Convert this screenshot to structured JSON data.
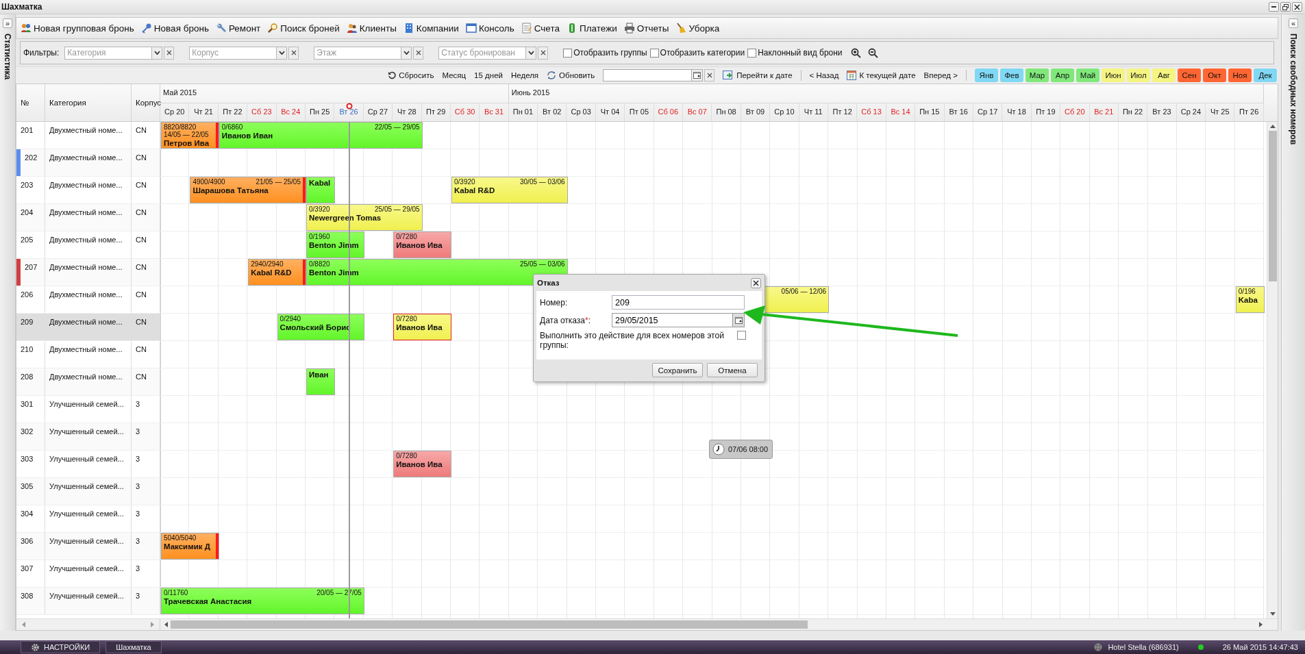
{
  "window": {
    "title": "Шахматка"
  },
  "left_panel": {
    "toggle": "»",
    "title": "Статистика"
  },
  "right_panel": {
    "toggle": "«",
    "title": "Поиск свободных номеров"
  },
  "toolbar": [
    "Новая групповая бронь",
    "Новая бронь",
    "Ремонт",
    "Поиск броней",
    "Клиенты",
    "Компании",
    "Консоль",
    "Счета",
    "Платежи",
    "Отчеты",
    "Уборка"
  ],
  "filters": {
    "label": "Фильтры:",
    "combos": [
      {
        "placeholder": "Категория"
      },
      {
        "placeholder": "Корпус"
      },
      {
        "placeholder": "Этаж"
      },
      {
        "placeholder": "Статус бронирован"
      }
    ],
    "checkboxes": [
      {
        "label": "Отобразить группы",
        "checked": false
      },
      {
        "label": "Отобразить категории",
        "checked": false
      },
      {
        "label": "Наклонный вид брони",
        "checked": false
      }
    ]
  },
  "nav": {
    "reset": "Сбросить",
    "views": [
      "Месяц",
      "15 дней",
      "Неделя"
    ],
    "refresh": "Обновить",
    "goto": "Перейти к дате",
    "back": "< Назад",
    "today": "К текущей дате",
    "forward": "Вперед >",
    "months": [
      {
        "label": "Янв",
        "color": "#80d8f4"
      },
      {
        "label": "Фев",
        "color": "#80d8f4"
      },
      {
        "label": "Мар",
        "color": "#80e87a"
      },
      {
        "label": "Апр",
        "color": "#80e87a"
      },
      {
        "label": "Май",
        "color": "#80e87a"
      },
      {
        "label": "Июн",
        "color": "#f4f482"
      },
      {
        "label": "Июл",
        "color": "#f4f482"
      },
      {
        "label": "Авг",
        "color": "#f4f482"
      },
      {
        "label": "Сен",
        "color": "#ff6633"
      },
      {
        "label": "Окт",
        "color": "#ff6633"
      },
      {
        "label": "Ноя",
        "color": "#ff6633"
      },
      {
        "label": "Дек",
        "color": "#80d8f4"
      }
    ]
  },
  "grid": {
    "columns": [
      "№",
      "Категория",
      "Корпус"
    ],
    "months": [
      {
        "label": "Май 2015",
        "days": [
          {
            "label": "Ср 20",
            "kind": "weekday"
          },
          {
            "label": "Чт 21",
            "kind": "weekday"
          },
          {
            "label": "Пт 22",
            "kind": "weekday"
          },
          {
            "label": "Сб 23",
            "kind": "weekend"
          },
          {
            "label": "Вс 24",
            "kind": "weekend"
          },
          {
            "label": "Пн 25",
            "kind": "weekday"
          },
          {
            "label": "Вт 26",
            "kind": "today"
          },
          {
            "label": "Ср 27",
            "kind": "weekday"
          },
          {
            "label": "Чт 28",
            "kind": "weekday"
          },
          {
            "label": "Пт 29",
            "kind": "weekday"
          },
          {
            "label": "Сб 30",
            "kind": "weekend"
          },
          {
            "label": "Вс 31",
            "kind": "weekend"
          }
        ]
      },
      {
        "label": "Июнь 2015",
        "days": [
          {
            "label": "Пн 01",
            "kind": "weekday"
          },
          {
            "label": "Вт 02",
            "kind": "weekday"
          },
          {
            "label": "Ср 03",
            "kind": "weekday"
          },
          {
            "label": "Чт 04",
            "kind": "weekday"
          },
          {
            "label": "Пт 05",
            "kind": "weekday"
          },
          {
            "label": "Сб 06",
            "kind": "weekend"
          },
          {
            "label": "Вс 07",
            "kind": "weekend"
          },
          {
            "label": "Пн 08",
            "kind": "weekday"
          },
          {
            "label": "Вт 09",
            "kind": "weekday"
          },
          {
            "label": "Ср 10",
            "kind": "weekday"
          },
          {
            "label": "Чт 11",
            "kind": "weekday"
          },
          {
            "label": "Пт 12",
            "kind": "weekday"
          },
          {
            "label": "Сб 13",
            "kind": "weekend"
          },
          {
            "label": "Вс 14",
            "kind": "weekend"
          },
          {
            "label": "Пн 15",
            "kind": "weekday"
          },
          {
            "label": "Вт 16",
            "kind": "weekday"
          },
          {
            "label": "Ср 17",
            "kind": "weekday"
          },
          {
            "label": "Чт 18",
            "kind": "weekday"
          },
          {
            "label": "Пт 19",
            "kind": "weekday"
          },
          {
            "label": "Сб 20",
            "kind": "weekend"
          },
          {
            "label": "Вс 21",
            "kind": "weekend"
          },
          {
            "label": "Пн 22",
            "kind": "weekday"
          },
          {
            "label": "Вт 23",
            "kind": "weekday"
          },
          {
            "label": "Ср 24",
            "kind": "weekday"
          },
          {
            "label": "Чт 25",
            "kind": "weekday"
          },
          {
            "label": "Пт 26",
            "kind": "weekday"
          }
        ]
      }
    ],
    "rows": [
      {
        "number": "201",
        "category": "Двухместный номе...",
        "building": "CN",
        "selected": false,
        "timeline": [
          {
            "kind": "paid",
            "amount": "8820/8820",
            "dates": "14/05 — 22/05",
            "guest": "Петров Ива",
            "selected": false,
            "nights": [
              {
                "kind": "night"
              },
              {
                "kind": "night"
              }
            ]
          },
          {
            "kind": "checked_in",
            "amount": "0/6860",
            "dates": "22/05 — 29/05",
            "guest": "Иванов Иван",
            "selected": false,
            "nights": [
              {
                "kind": "night"
              },
              {
                "kind": "night"
              },
              {
                "kind": "night"
              },
              {
                "kind": "night"
              },
              {
                "kind": "night"
              },
              {
                "kind": "night"
              },
              {
                "kind": "night"
              }
            ]
          }
        ]
      },
      {
        "number": "202",
        "category": "Двухместный номе...",
        "building": "CN",
        "selected": false,
        "color": "#5b8def"
      },
      {
        "number": "203",
        "category": "Двухместный номе...",
        "building": "CN",
        "selected": false,
        "timeline": [
          {
            "kind": "free"
          },
          {
            "kind": "paid",
            "amount": "4900/4900",
            "dates": "21/05 — 25/05",
            "guest": "Шарашова Татьяна",
            "selected": false,
            "nights": [
              {
                "kind": "night"
              },
              {
                "kind": "night"
              },
              {
                "kind": "night"
              },
              {
                "kind": "night"
              }
            ]
          },
          {
            "kind": "checked_in",
            "guest": "Kabal",
            "selected": false,
            "nights": [
              {
                "kind": "night"
              }
            ]
          },
          {
            "kind": "free"
          },
          {
            "kind": "free"
          },
          {
            "kind": "free"
          },
          {
            "kind": "free"
          },
          {
            "kind": "reserved",
            "amount": "0/3920",
            "dates": "30/05 — 03/06",
            "guest": "Kabal R&D",
            "selected": false,
            "nights": [
              {
                "kind": "night"
              },
              {
                "kind": "night"
              },
              {
                "kind": "night"
              },
              {
                "kind": "night"
              }
            ]
          }
        ]
      },
      {
        "number": "204",
        "category": "Двухместный номе...",
        "building": "CN",
        "selected": false,
        "timeline": [
          {
            "kind": "free"
          },
          {
            "kind": "free"
          },
          {
            "kind": "free"
          },
          {
            "kind": "free"
          },
          {
            "kind": "free"
          },
          {
            "kind": "reserved",
            "amount": "0/3920",
            "dates": "25/05 — 29/05",
            "guest": "Newergreen Tomas",
            "selected": false,
            "nights": [
              {
                "kind": "night"
              },
              {
                "kind": "night"
              },
              {
                "kind": "night"
              },
              {
                "kind": "night"
              }
            ]
          }
        ]
      },
      {
        "number": "205",
        "category": "Двухместный номе...",
        "building": "CN",
        "selected": false,
        "timeline": [
          {
            "kind": "free"
          },
          {
            "kind": "free"
          },
          {
            "kind": "free"
          },
          {
            "kind": "free"
          },
          {
            "kind": "free"
          },
          {
            "kind": "checked_in",
            "amount": "0/1960",
            "guest": "Benton Jimm",
            "selected": false,
            "nights": [
              {
                "kind": "night"
              },
              {
                "kind": "night"
              }
            ]
          },
          {
            "kind": "free"
          },
          {
            "kind": "cancelled",
            "amount": "0/7280",
            "guest": "Иванов Ива",
            "selected": false,
            "nights": [
              {
                "kind": "night"
              },
              {
                "kind": "night"
              }
            ]
          }
        ]
      },
      {
        "number": "207",
        "category": "Двухместный номе...",
        "building": "CN",
        "selected": false,
        "color": "#d04040",
        "timeline": [
          {
            "kind": "free"
          },
          {
            "kind": "free"
          },
          {
            "kind": "free"
          },
          {
            "kind": "paid",
            "amount": "2940/2940",
            "guest": "Kabal R&D",
            "selected": false,
            "nights": [
              {
                "kind": "night"
              },
              {
                "kind": "night"
              }
            ]
          },
          {
            "kind": "checked_in",
            "amount": "0/8820",
            "dates": "25/05 — 03/06",
            "guest": "Benton Jimm",
            "selected": false,
            "nights": [
              {
                "kind": "night"
              },
              {
                "kind": "night"
              },
              {
                "kind": "night"
              },
              {
                "kind": "night"
              },
              {
                "kind": "night"
              },
              {
                "kind": "night"
              },
              {
                "kind": "night"
              },
              {
                "kind": "night"
              },
              {
                "kind": "night"
              }
            ]
          }
        ]
      },
      {
        "number": "206",
        "category": "Двухместный номе...",
        "building": "CN",
        "selected": false,
        "timeline": [
          {
            "kind": "free"
          },
          {
            "kind": "free"
          },
          {
            "kind": "free"
          },
          {
            "kind": "free"
          },
          {
            "kind": "free"
          },
          {
            "kind": "free"
          },
          {
            "kind": "free"
          },
          {
            "kind": "free"
          },
          {
            "kind": "free"
          },
          {
            "kind": "free"
          },
          {
            "kind": "free"
          },
          {
            "kind": "free"
          },
          {
            "kind": "free"
          },
          {
            "kind": "free"
          },
          {
            "kind": "free"
          },
          {
            "kind": "free"
          },
          {
            "kind": "reserved",
            "dates": "05/06 — 12/06",
            "selected": false,
            "nights": [
              {
                "kind": "night"
              },
              {
                "kind": "night"
              },
              {
                "kind": "night"
              },
              {
                "kind": "night"
              },
              {
                "kind": "night"
              },
              {
                "kind": "night"
              },
              {
                "kind": "night"
              }
            ]
          },
          {
            "kind": "free"
          },
          {
            "kind": "free"
          },
          {
            "kind": "free"
          },
          {
            "kind": "free"
          },
          {
            "kind": "free"
          },
          {
            "kind": "free"
          },
          {
            "kind": "free"
          },
          {
            "kind": "free"
          },
          {
            "kind": "free"
          },
          {
            "kind": "free"
          },
          {
            "kind": "free"
          },
          {
            "kind": "free"
          },
          {
            "kind": "free"
          },
          {
            "kind": "free"
          },
          {
            "kind": "reserved",
            "amount": "0/196",
            "guest": "Kaba",
            "selected": false,
            "nights": [
              {
                "kind": "night"
              }
            ]
          }
        ]
      },
      {
        "number": "209",
        "category": "Двухместный номе...",
        "building": "CN",
        "selected": true,
        "timeline": [
          {
            "kind": "free"
          },
          {
            "kind": "free"
          },
          {
            "kind": "free"
          },
          {
            "kind": "free"
          },
          {
            "kind": "checked_in",
            "amount": "0/2940",
            "guest": "Смольский Борис",
            "selected": false,
            "nights": [
              {
                "kind": "night"
              },
              {
                "kind": "night"
              },
              {
                "kind": "night"
              }
            ]
          },
          {
            "kind": "free"
          },
          {
            "kind": "reserved",
            "amount": "0/7280",
            "guest": "Иванов Ива",
            "selected": true,
            "nights": [
              {
                "kind": "night"
              },
              {
                "kind": "night"
              }
            ]
          }
        ]
      },
      {
        "number": "210",
        "category": "Двухместный номе...",
        "building": "CN",
        "selected": false
      },
      {
        "number": "208",
        "category": "Двухместный номе...",
        "building": "CN",
        "selected": false,
        "timeline": [
          {
            "kind": "free"
          },
          {
            "kind": "free"
          },
          {
            "kind": "free"
          },
          {
            "kind": "free"
          },
          {
            "kind": "free"
          },
          {
            "kind": "checked_in",
            "guest": "Иван",
            "selected": false,
            "nights": [
              {
                "kind": "night"
              }
            ]
          }
        ]
      },
      {
        "number": "301",
        "category": "Улучшенный семей...",
        "building": "3",
        "selected": false
      },
      {
        "number": "302",
        "category": "Улучшенный семей...",
        "building": "3",
        "selected": false
      },
      {
        "number": "303",
        "category": "Улучшенный семей...",
        "building": "3",
        "selected": false,
        "timeline": [
          {
            "kind": "free"
          },
          {
            "kind": "free"
          },
          {
            "kind": "free"
          },
          {
            "kind": "free"
          },
          {
            "kind": "free"
          },
          {
            "kind": "free"
          },
          {
            "kind": "free"
          },
          {
            "kind": "free"
          },
          {
            "kind": "cancelled",
            "amount": "0/7280",
            "guest": "Иванов Ива",
            "selected": false,
            "nights": [
              {
                "kind": "night"
              },
              {
                "kind": "night"
              }
            ]
          }
        ]
      },
      {
        "number": "305",
        "category": "Улучшенный семей...",
        "building": "3",
        "selected": false
      },
      {
        "number": "304",
        "category": "Улучшенный семей...",
        "building": "3",
        "selected": false
      },
      {
        "number": "306",
        "category": "Улучшенный семей...",
        "building": "3",
        "selected": false,
        "timeline": [
          {
            "kind": "paid",
            "amount": "5040/5040",
            "guest": "Максимик Д",
            "selected": false,
            "nights": [
              {
                "kind": "night"
              },
              {
                "kind": "night"
              }
            ]
          }
        ]
      },
      {
        "number": "307",
        "category": "Улучшенный семей...",
        "building": "3",
        "selected": false
      },
      {
        "number": "308",
        "category": "Улучшенный семей...",
        "building": "3",
        "selected": false,
        "timeline": [
          {
            "kind": "checked_in",
            "amount": "0/11760",
            "dates": "20/05 — 27/05",
            "guest": "Трачевская Анастасия",
            "selected": false,
            "nights": [
              {
                "kind": "night"
              },
              {
                "kind": "night"
              },
              {
                "kind": "night"
              },
              {
                "kind": "night"
              },
              {
                "kind": "night"
              },
              {
                "kind": "night"
              },
              {
                "kind": "night"
              }
            ]
          }
        ]
      }
    ]
  },
  "dialog": {
    "title": "Отказ",
    "fields": [
      {
        "label": "Номер:",
        "value": "209",
        "kind": "text"
      },
      {
        "label": "Дата отказа",
        "required_mark": "*",
        "suffix": ":",
        "value": "29/05/2015",
        "kind": "date"
      }
    ],
    "checkbox": {
      "label": "Выполнить это действие для всех номеров этой группы:",
      "checked": false
    },
    "buttons": [
      "Сохранить",
      "Отмена"
    ]
  },
  "tooltip": {
    "time": "07/06 08:00"
  },
  "taskbar": {
    "buttons": [
      "НАСТРОЙКИ",
      "Шахматка"
    ],
    "hotel": "Hotel Stella (686931)",
    "clock": "26 Май 2015 14:47:43"
  }
}
